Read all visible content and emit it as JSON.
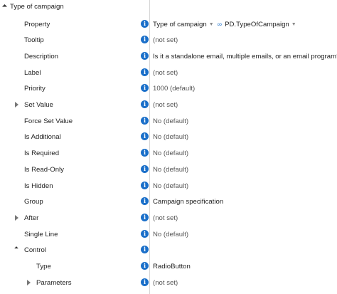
{
  "group": {
    "label": "Type of campaign"
  },
  "rows": [
    {
      "name": "Property",
      "value": "Type of campaign",
      "link": "PD.TypeOfCampaign"
    },
    {
      "name": "Tooltip",
      "value": "(not set)"
    },
    {
      "name": "Description",
      "value": "Is it a standalone email, multiple emails, or an email program?"
    },
    {
      "name": "Label",
      "value": "(not set)"
    },
    {
      "name": "Priority",
      "value": "1000 (default)"
    },
    {
      "name": "Set Value",
      "value": "(not set)"
    },
    {
      "name": "Force Set Value",
      "value": "No (default)"
    },
    {
      "name": "Is Additional",
      "value": "No (default)"
    },
    {
      "name": "Is Required",
      "value": "No (default)"
    },
    {
      "name": "Is Read-Only",
      "value": "No (default)"
    },
    {
      "name": "Is Hidden",
      "value": "No (default)"
    },
    {
      "name": "Group",
      "value": "Campaign specification"
    },
    {
      "name": "After",
      "value": "(not set)"
    },
    {
      "name": "Single Line",
      "value": "No (default)"
    },
    {
      "name": "Control",
      "value": ""
    },
    {
      "name": "Type",
      "value": "RadioButton"
    },
    {
      "name": "Parameters",
      "value": "(not set)"
    }
  ],
  "icons": {
    "info": "info-icon",
    "expand": "expand-arrow-icon",
    "collapse": "collapse-arrow-icon",
    "dropdown": "dropdown-arrow-icon",
    "link": "link-icon"
  },
  "colors": {
    "accent": "#1a6fc9",
    "separator": "#d6d6d6"
  }
}
